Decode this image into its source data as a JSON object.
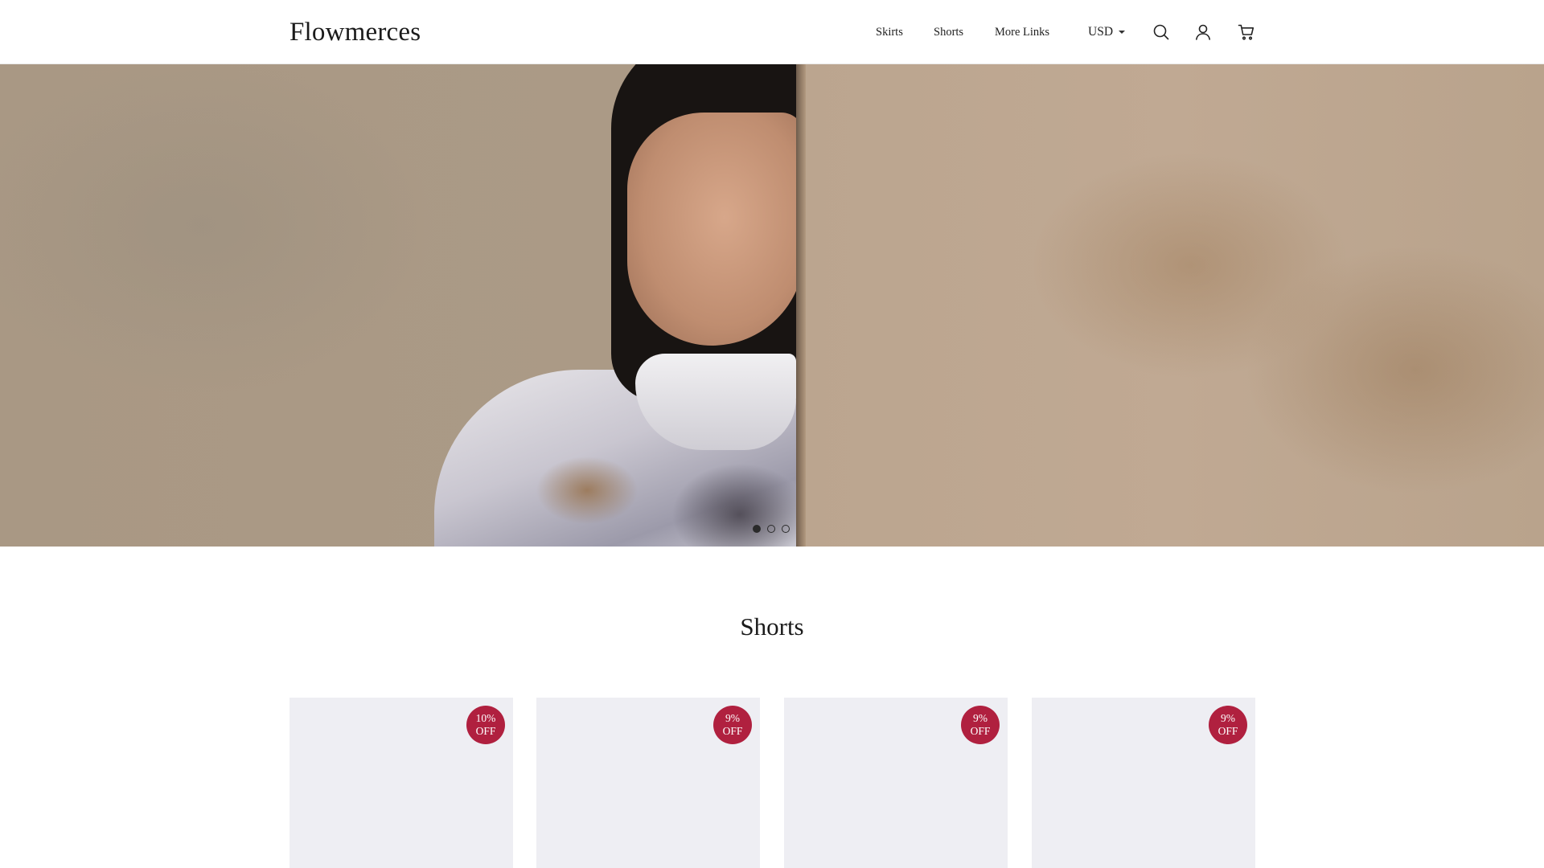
{
  "header": {
    "logo": "Flowmerces",
    "nav": [
      "Skirts",
      "Shorts",
      "More Links"
    ],
    "currency": "USD",
    "icons": [
      "search-icon",
      "user-icon",
      "cart-icon"
    ]
  },
  "hero": {
    "slide_count": 3,
    "active_slide": 1
  },
  "section": {
    "title": "Shorts",
    "products": [
      {
        "discount_pct": "10%",
        "discount_off": "OFF"
      },
      {
        "discount_pct": "9%",
        "discount_off": "OFF"
      },
      {
        "discount_pct": "9%",
        "discount_off": "OFF"
      },
      {
        "discount_pct": "9%",
        "discount_off": "OFF"
      }
    ]
  },
  "colors": {
    "badge": "#b0203f",
    "card_bg": "#eeeef3",
    "text": "#1b1b1b"
  }
}
